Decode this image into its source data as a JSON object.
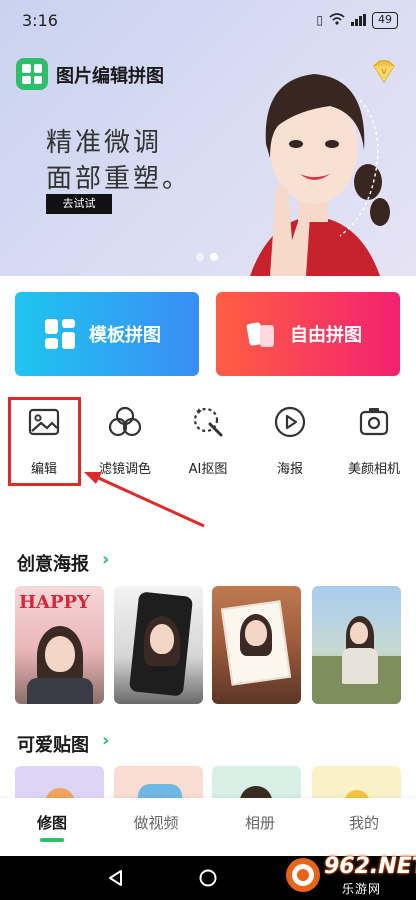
{
  "status_bar": {
    "time": "3:16",
    "battery": "49"
  },
  "banner": {
    "app_title": "图片编辑拼图",
    "headline_line1": "精准微调",
    "headline_line2": "面部重塑。",
    "try_button": "去试试",
    "slide_count": 2,
    "active_slide": 2
  },
  "main_cards": [
    {
      "label": "模板拼图",
      "icon": "grid-layout-icon"
    },
    {
      "label": "自由拼图",
      "icon": "free-collage-icon"
    }
  ],
  "tools": [
    {
      "label": "编辑",
      "icon": "image-edit-icon"
    },
    {
      "label": "滤镜调色",
      "icon": "filter-circles-icon"
    },
    {
      "label": "AI抠图",
      "icon": "ai-cutout-icon"
    },
    {
      "label": "海报",
      "icon": "play-circle-icon"
    },
    {
      "label": "美颜相机",
      "icon": "camera-icon"
    }
  ],
  "sections": {
    "posters_title": "创意海报",
    "posters_thumb_text": "HAPPY",
    "stickers_title": "可爱贴图"
  },
  "bottom_nav": [
    {
      "label": "修图",
      "active": true
    },
    {
      "label": "做视频",
      "active": false
    },
    {
      "label": "相册",
      "active": false
    },
    {
      "label": "我的",
      "active": false
    }
  ],
  "watermark": {
    "text": "962.NET",
    "sub": "乐游网"
  },
  "colors": {
    "accent_green": "#2dbe6c",
    "highlight_red": "#e02a2a",
    "template_card": "#2aa8f2",
    "free_card": "#f84158"
  }
}
